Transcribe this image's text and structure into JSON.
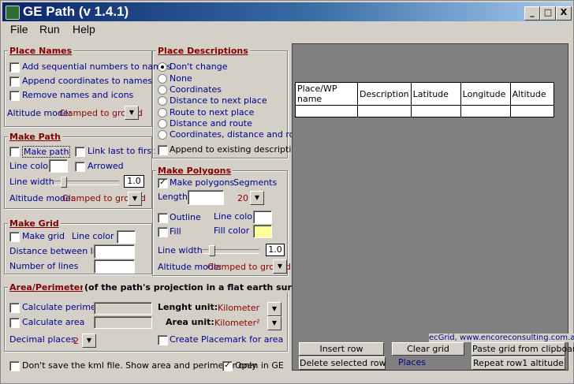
{
  "window": {
    "title": "GE Path (v 1.4.1)",
    "minimize": "_",
    "maximize": "□",
    "close": "X"
  },
  "menu": [
    "File",
    "Run",
    "Help"
  ],
  "place_names": {
    "title": "Place Names",
    "options": [
      "Add sequential numbers to names",
      "Append coordinates to names",
      "Remove names and icons"
    ],
    "altitude_label": "Altitude mode:",
    "altitude_value": "Clamped to ground"
  },
  "make_path": {
    "title": "Make Path",
    "make_path": "Make path",
    "link_last": "Link last to first",
    "line_color": "Line color",
    "arrowed": "Arrowed",
    "line_width": "Line width",
    "line_width_value": "1.0",
    "altitude_label": "Altitude mode:",
    "altitude_value": "Clamped to ground"
  },
  "make_grid": {
    "title": "Make Grid",
    "make_grid": "Make grid",
    "line_color": "Line color",
    "distance": "Distance between lines",
    "number": "Number of  lines"
  },
  "area": {
    "title": "Area/Perimeter",
    "subtitle": "(of the path's projection in a flat earth surface)",
    "calc_perimeter": "Calculate perimeter",
    "calc_area": "Calculate area",
    "length_unit_label": "Lenght unit:",
    "length_unit_value": "Kilometer",
    "area_unit_label": "Area unit:",
    "area_unit_value": "Kilometer²",
    "decimal_label": "Decimal places",
    "decimal_value": "2",
    "create_placemark": "Create Placemark for area"
  },
  "place_descriptions": {
    "title": "Place Descriptions",
    "options": [
      "Don't change",
      "None",
      "Coordinates",
      "Distance to next place",
      "Route to next place",
      "Distance and route",
      "Coordinates, distance and route"
    ],
    "selected": 0,
    "append": "Append to existing description"
  },
  "make_polygons": {
    "title": "Make Polygons",
    "make_polygons": "Make polygons",
    "segments_label": "Segments",
    "length_label": "Length",
    "segments_value": "20",
    "outline": "Outline",
    "outline_color": "Line color",
    "fill": "Fill",
    "fill_color_label": "Fill color",
    "fill_color": "#ffff99",
    "line_width": "Line width",
    "line_width_value": "1.0",
    "altitude_label": "Altitude mode:",
    "altitude_value": "Clamped to ground"
  },
  "bottom": {
    "dont_save": "Don't save the kml file. Show area and perimeter only",
    "open_ge": "Open in GE"
  },
  "grid": {
    "columns": [
      "Place/WP name",
      "Description",
      "Latitude",
      "Longitude",
      "Altitude"
    ],
    "credit": "ecGrid,  www.encoreconsulting.com.au"
  },
  "buttons": {
    "insert_row": "Insert row",
    "clear_grid": "Clear grid",
    "paste_grid": "Paste grid from clipboard",
    "delete_row": "Delete selected row",
    "places": "Places",
    "repeat_row": "Repeat row1 altitude"
  },
  "colors": {
    "link": "#00008b",
    "title": "#800000",
    "value": "#8b0000"
  }
}
